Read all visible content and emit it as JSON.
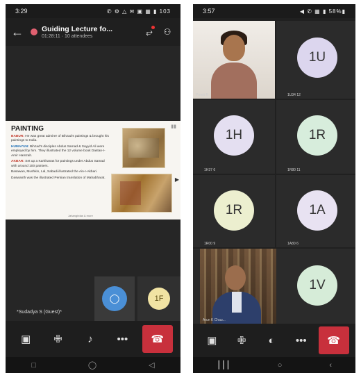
{
  "left_phone": {
    "status": {
      "time": "3:29",
      "icons": "✆ ⚙ △ ✉ ▣ ▦ ▮ 103"
    },
    "header": {
      "title": "Guiding Lecture fo...",
      "subtitle": "01:28:11 · 10 attendees"
    },
    "slide": {
      "title": "PAINTING",
      "lines": [
        {
          "head": "BABUR:",
          "text": " He was great admirer of Bihzad's paintings & brought his paintings to India."
        },
        {
          "head": "HUMAYUN:",
          "text": " Bihzad's disciples Abdus Samad & Sayyid Ali were employed by him. They illustrated the 12 volume book Dastan-I-Amir Hamzah."
        },
        {
          "head": "AKBAR:",
          "text": " Set up a Karkhanas for paintings under Abdus Samad with around 100 painters."
        },
        {
          "head": "",
          "text": "Basawan, Mushkin, Lal, Sabadi illustrated the Ain-I-Akbari."
        },
        {
          "head": "",
          "text": "Daswanth was the illustrated Persian translation of Mahabharat."
        }
      ],
      "footer": "Jahangirdas & more"
    },
    "guest_label": "*Sudadya S (Guest)*",
    "tiles": {
      "tile_1f": "1F"
    }
  },
  "right_phone": {
    "status": {
      "time": "3:57",
      "icons": "◀ ✆ ▦ ▮ 58%▮"
    },
    "tiles": [
      {
        "initials": "1U"
      },
      {
        "initials": "1H"
      },
      {
        "initials": "1R"
      },
      {
        "initials": "1R"
      },
      {
        "initials": "1A"
      },
      {
        "initials": "1V"
      }
    ],
    "captions": {
      "video_f": "Preeti R",
      "tile_1u": "1U34 12",
      "tile_1h": "1H37 6",
      "tile_1r1": "1R80 11",
      "tile_1r2": "1R00 9",
      "tile_1a": "1A80 6",
      "video_m": "Arun K Chau..."
    }
  },
  "icons": {
    "back": "←",
    "share": "⥂",
    "people": "⚇",
    "camera_off": "▣",
    "mic_off": "✙",
    "speaker": "♪",
    "headset": "◐",
    "more": "•••",
    "end_call": "☎",
    "nav_recent": "┃┃┃",
    "nav_home": "○",
    "nav_back": "‹",
    "nav_square": "□",
    "nav_circle": "◯",
    "nav_tri": "◁"
  },
  "colors": {
    "end_call": "#c8303c",
    "record": "#e06070",
    "self_avatar": "#4a8fd6"
  }
}
